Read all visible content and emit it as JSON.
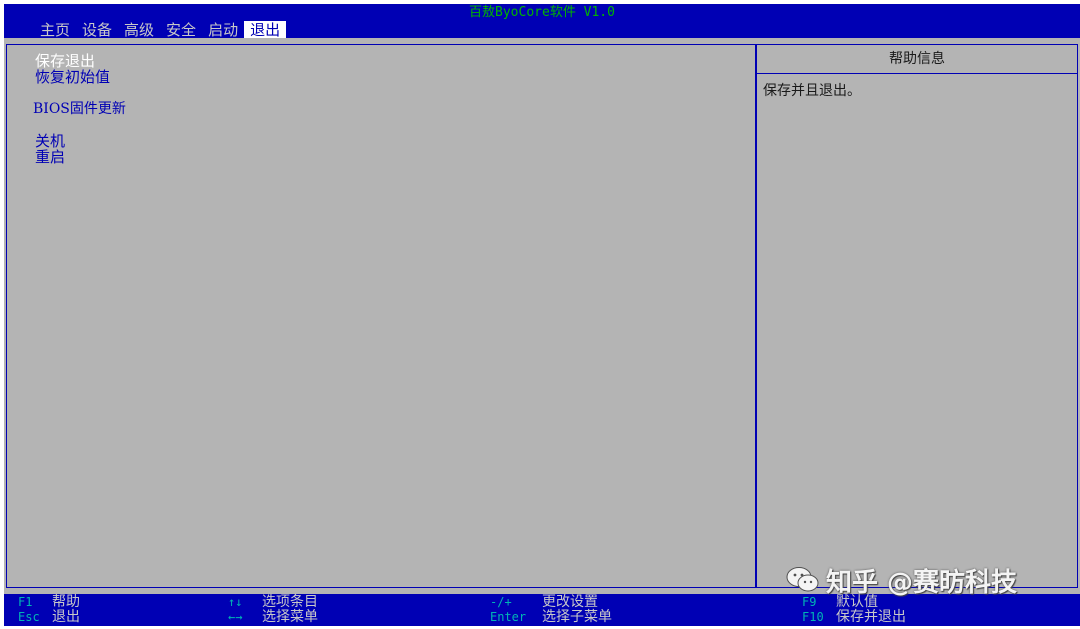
{
  "window": {
    "title": "百敖ByoCore软件 V1.0"
  },
  "tabs": [
    {
      "label": "主页",
      "active": false
    },
    {
      "label": "设备",
      "active": false
    },
    {
      "label": "高级",
      "active": false
    },
    {
      "label": "安全",
      "active": false
    },
    {
      "label": "启动",
      "active": false
    },
    {
      "label": "退出",
      "active": true
    }
  ],
  "menu": {
    "items": [
      {
        "label": "保存退出",
        "selected": true
      },
      {
        "label": "恢复初始值",
        "selected": false
      },
      {
        "label": "BIOS固件更新",
        "selected": false
      },
      {
        "label": "关机",
        "selected": false
      },
      {
        "label": "重启",
        "selected": false
      }
    ]
  },
  "help": {
    "header": "帮助信息",
    "text": "保存并且退出。"
  },
  "footer": {
    "keys": [
      {
        "key": "F1",
        "desc": "帮助"
      },
      {
        "key": "Esc",
        "desc": "退出"
      },
      {
        "key": "↑↓",
        "desc": "选项条目"
      },
      {
        "key": "←→",
        "desc": "选择菜单"
      },
      {
        "key": "-/+",
        "desc": "更改设置"
      },
      {
        "key": "Enter",
        "desc": "选择子菜单"
      },
      {
        "key": "F9",
        "desc": "默认值"
      },
      {
        "key": "F10",
        "desc": "保存并退出"
      }
    ]
  },
  "watermark": {
    "icon": "wechat-icon",
    "text": "知乎 @赛昉科技"
  },
  "colors": {
    "bar_blue": "#0000b4",
    "panel_gray": "#b4b4b4",
    "title_green": "#00b400",
    "key_cyan": "#00b4b4",
    "menu_text": "#0000b4",
    "selected_text": "#ffffff"
  }
}
